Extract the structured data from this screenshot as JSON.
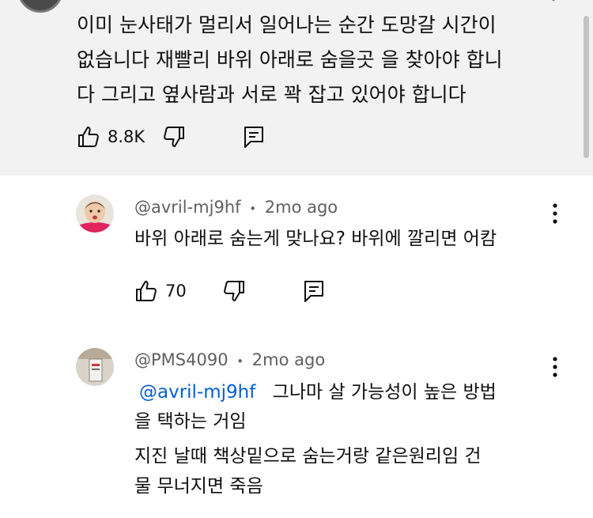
{
  "top_comment": {
    "text_lines": [
      "이미  눈사태가 멀리서 일어나는 순간  도망갈 시간이",
      "없습니다  재빨리  바위 아래로 숨을곳 을 찾아야 합니",
      "다  그리고 옆사람과 서로 꽉 잡고 있어야 합니다"
    ],
    "like_count": "8.8K"
  },
  "replies": [
    {
      "author": "@avril-mj9hf",
      "separator": "•",
      "time": "2mo ago",
      "text": "바위 아래로 숨는게 맞나요? 바위에 깔리면 어캄",
      "like_count": "70"
    },
    {
      "author": "@PMS4090",
      "separator": "•",
      "time": "2mo ago",
      "mention": "@avril-mj9hf",
      "text_line1_rest": "그나마 살 가능성이 높은 방법",
      "text_line2": "을 택하는 거임",
      "text_line3": " 지진 날때 책상밑으로 숨는거랑 같은원리임 건",
      "text_line4": "물 무너지면 죽음"
    }
  ],
  "icons": [
    "like-icon",
    "dislike-icon",
    "reply-icon",
    "more-icon"
  ],
  "colors": {
    "top_comment_bg": "#f2f2f2",
    "meta_text": "#606060",
    "mention": "#065fd4",
    "text": "#0f0f0f"
  }
}
